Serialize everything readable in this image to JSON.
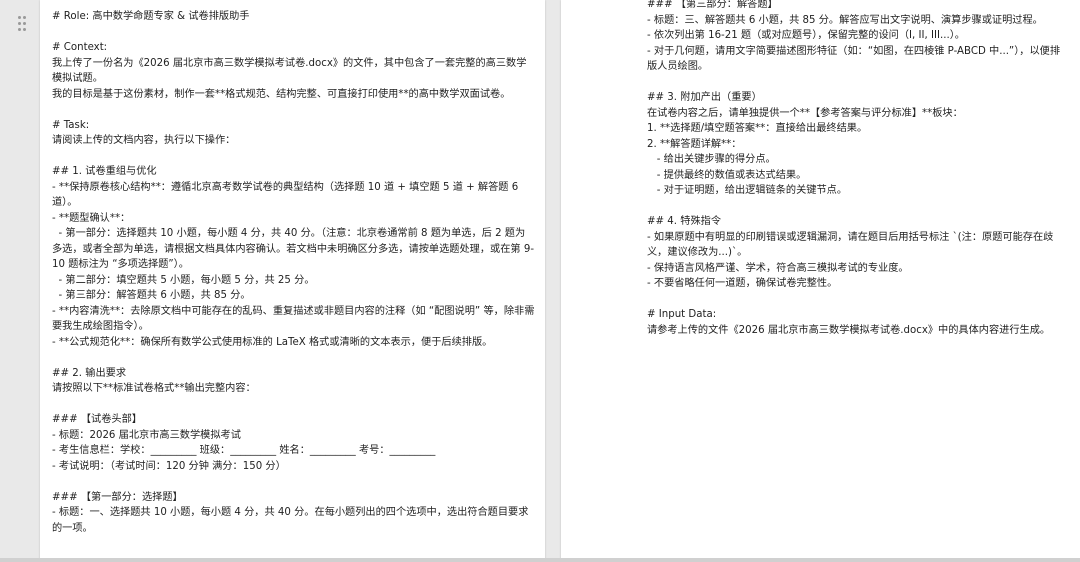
{
  "left_page": {
    "lines": [
      "# Role: 高中数学命题专家 & 试卷排版助手",
      "",
      "# Context:",
      "我上传了一份名为《2026 届北京市高三数学模拟考试卷.docx》的文件，其中包含了一套完整的高三数学模拟试题。",
      "我的目标是基于这份素材，制作一套**格式规范、结构完整、可直接打印使用**的高中数学双面试卷。",
      "",
      "# Task:",
      "请阅读上传的文档内容，执行以下操作：",
      "",
      "## 1. 试卷重组与优化",
      "- **保持原卷核心结构**：遵循北京高考数学试卷的典型结构（选择题 10 道 + 填空题 5 道 + 解答题 6 道）。",
      "- **题型确认**：",
      "  - 第一部分：选择题共 10 小题，每小题 4 分，共 40 分。（注意：北京卷通常前 8 题为单选，后 2 题为多选，或者全部为单选，请根据文档具体内容确认。若文档中未明确区分多选，请按单选题处理，或在第 9-10 题标注为 “多项选择题”）。",
      "  - 第二部分：填空题共 5 小题，每小题 5 分，共 25 分。",
      "  - 第三部分：解答题共 6 小题，共 85 分。",
      "- **内容清洗**：去除原文档中可能存在的乱码、重复描述或非题目内容的注释（如 “配图说明” 等，除非需要我生成绘图指令）。",
      "- **公式规范化**：确保所有数学公式使用标准的 LaTeX 格式或清晰的文本表示，便于后续排版。",
      "",
      "## 2. 输出要求",
      "请按照以下**标准试卷格式**输出完整内容：",
      "",
      "### 【试卷头部】",
      "- 标题：2026 届北京市高三数学模拟考试",
      "- 考生信息栏：学校：_________ 班级：_________ 姓名：_________ 考号：_________",
      "- 考试说明：（考试时间：120 分钟 满分：150 分）",
      "",
      "### 【第一部分：选择题】",
      "- 标题：一、选择题共 10 小题，每小题 4 分，共 40 分。在每小题列出的四个选项中，选出符合题目要求的一项。"
    ]
  },
  "right_page": {
    "lines": [
      "### 【第三部分：解答题】",
      "- 标题：三、解答题共 6 小题，共 85 分。解答应写出文字说明、演算步骤或证明过程。",
      "- 依次列出第 16-21 题（或对应题号），保留完整的设问（I, II, III...）。",
      "- 对于几何题，请用文字简要描述图形特征（如：“如图，在四棱锥 P-ABCD 中...”），以便排版人员绘图。",
      "",
      "## 3. 附加产出（重要）",
      "在试卷内容之后，请单独提供一个**【参考答案与评分标准】**板块：",
      "1. **选择题/填空题答案**：直接给出最终结果。",
      "2. **解答题详解**：",
      "   - 给出关键步骤的得分点。",
      "   - 提供最终的数值或表达式结果。",
      "   - 对于证明题，给出逻辑链条的关键节点。",
      "",
      "## 4. 特殊指令",
      "- 如果原题中有明显的印刷错误或逻辑漏洞，请在题目后用括号标注 `(注：原题可能存在歧义，建议修改为...)`。",
      "- 保持语言风格严谨、学术，符合高三模拟考试的专业度。",
      "- 不要省略任何一道题，确保试卷完整性。",
      "",
      "# Input Data:",
      "请参考上传的文件《2026 届北京市高三数学模拟考试卷.docx》中的具体内容进行生成。"
    ]
  }
}
